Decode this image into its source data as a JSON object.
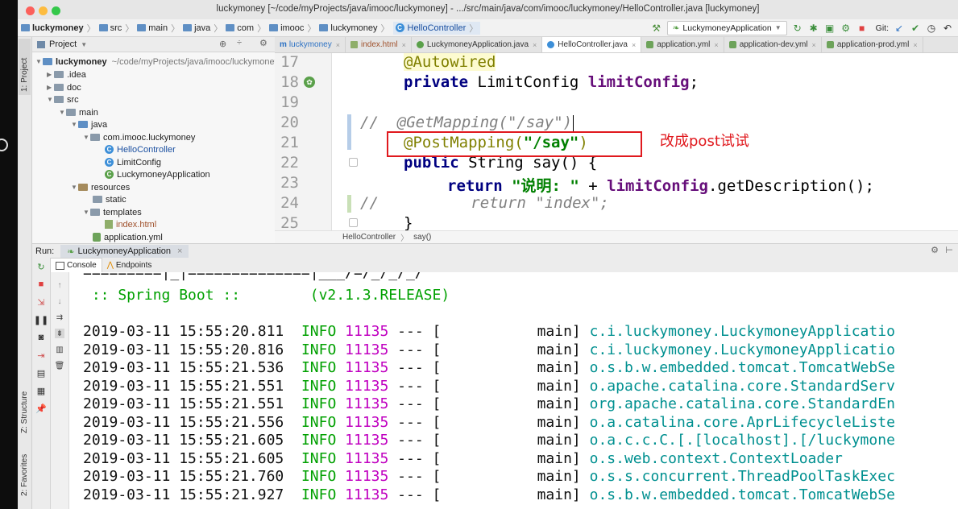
{
  "window": {
    "title": "luckymoney [~/code/myProjects/java/imooc/luckymoney] - .../src/main/java/com/imooc/luckymoney/HelloController.java [luckymoney]"
  },
  "navbar": {
    "crumbs": [
      "luckymoney",
      "src",
      "main",
      "java",
      "com",
      "imooc",
      "luckymoney",
      "HelloController"
    ],
    "run_config": "LuckymoneyApplication",
    "git_label": "Git:"
  },
  "project": {
    "header": "Project",
    "root_name": "luckymoney",
    "root_path": "~/code/myProjects/java/imooc/luckymoney",
    "nodes": [
      ".idea",
      "doc",
      "src",
      "main",
      "java",
      "com.imooc.luckymoney",
      "HelloController",
      "LimitConfig",
      "LuckymoneyApplication",
      "resources",
      "static",
      "templates",
      "index.html",
      "application.yml"
    ]
  },
  "tabs": [
    "luckymoney",
    "index.html",
    "LuckymoneyApplication.java",
    "HelloController.java",
    "application.yml",
    "application-dev.yml",
    "application-prod.yml"
  ],
  "editor": {
    "line_numbers": [
      "17",
      "18",
      "19",
      "20",
      "21",
      "22",
      "23",
      "24",
      "25"
    ],
    "line17": "@Autowired",
    "line18_kw": "private",
    "line18_type": " LimitConfig ",
    "line18_field": "limitConfig",
    "line18_end": ";",
    "line20_comment": "//  @GetMapping(\"/say\")",
    "line21_ann": "@PostMapping(",
    "line21_str": "\"/say\"",
    "line21_end": ")",
    "line22_kw": "public",
    "line22_rest": " String say() {",
    "line23_kw": "return",
    "line23_str": " \"说明: \"",
    "line23_mid": " + ",
    "line23_field": "limitConfig",
    "line23_end": ".getDescription();",
    "line24_comment": "//          return \"index\";",
    "line25": "}",
    "annotation_note": "改成post试试",
    "breadcrumb_class": "HelloController",
    "breadcrumb_method": "say()"
  },
  "run": {
    "label": "Run:",
    "tab": "LuckymoneyApplication",
    "console_tab": "Console",
    "endpoints_tab": "Endpoints"
  },
  "console": {
    "banner_top": "=========|_|==============|___/=/_/_/_/",
    "banner": " :: Spring Boot ::        (v2.1.3.RELEASE)",
    "logs": [
      {
        "ts": "2019-03-11 15:55:20.811",
        "level": "INFO",
        "pid": "11135",
        "thread": "main",
        "logger": "c.i.luckymoney.LuckymoneyApplicatio"
      },
      {
        "ts": "2019-03-11 15:55:20.816",
        "level": "INFO",
        "pid": "11135",
        "thread": "main",
        "logger": "c.i.luckymoney.LuckymoneyApplicatio"
      },
      {
        "ts": "2019-03-11 15:55:21.536",
        "level": "INFO",
        "pid": "11135",
        "thread": "main",
        "logger": "o.s.b.w.embedded.tomcat.TomcatWebSe"
      },
      {
        "ts": "2019-03-11 15:55:21.551",
        "level": "INFO",
        "pid": "11135",
        "thread": "main",
        "logger": "o.apache.catalina.core.StandardServ"
      },
      {
        "ts": "2019-03-11 15:55:21.551",
        "level": "INFO",
        "pid": "11135",
        "thread": "main",
        "logger": "org.apache.catalina.core.StandardEn"
      },
      {
        "ts": "2019-03-11 15:55:21.556",
        "level": "INFO",
        "pid": "11135",
        "thread": "main",
        "logger": "o.a.catalina.core.AprLifecycleListe"
      },
      {
        "ts": "2019-03-11 15:55:21.605",
        "level": "INFO",
        "pid": "11135",
        "thread": "main",
        "logger": "o.a.c.c.C.[.[localhost].[/luckymone"
      },
      {
        "ts": "2019-03-11 15:55:21.605",
        "level": "INFO",
        "pid": "11135",
        "thread": "main",
        "logger": "o.s.web.context.ContextLoader"
      },
      {
        "ts": "2019-03-11 15:55:21.760",
        "level": "INFO",
        "pid": "11135",
        "thread": "main",
        "logger": "o.s.s.concurrent.ThreadPoolTaskExec"
      },
      {
        "ts": "2019-03-11 15:55:21.927",
        "level": "INFO",
        "pid": "11135",
        "thread": "main",
        "logger": "o.s.b.w.embedded.tomcat.TomcatWebSe"
      }
    ]
  },
  "side_labels": {
    "project": "1: Project",
    "structure": "Z: Structure",
    "favorites": "2: Favorites"
  },
  "colors": {
    "accent_red": "#e0191e",
    "spring_green": "#00a000",
    "pid_magenta": "#c000c0",
    "logger_teal": "#009090"
  }
}
